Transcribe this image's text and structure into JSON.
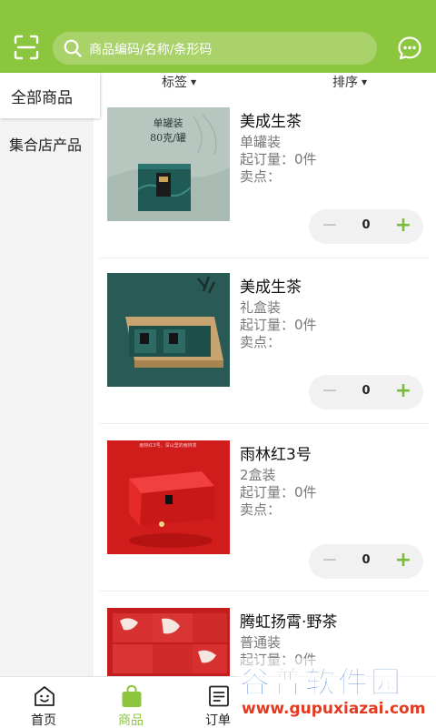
{
  "header": {
    "search_placeholder": "商品编码/名称/条形码",
    "accent_color": "#8cc63f",
    "left_icon": "scan-icon",
    "right_icon": "message-icon"
  },
  "sidebar": {
    "items": [
      {
        "label": "全部商品",
        "active": true
      },
      {
        "label": "集合店产品",
        "active": false
      }
    ]
  },
  "filters": {
    "tag_label": "标签",
    "sort_label": "排序"
  },
  "products": [
    {
      "name": "美成生茶",
      "spec": "单罐装",
      "moq": "起订量：0件",
      "selling_point": "卖点：",
      "qty": "0",
      "image_text": [
        "单罐装",
        "80克/罐"
      ]
    },
    {
      "name": "美成生茶",
      "spec": "礼盒装",
      "moq": "起订量：0件",
      "selling_point": "卖点：",
      "qty": "0"
    },
    {
      "name": "雨林红3号",
      "spec": "2盒装",
      "moq": "起订量：0件",
      "selling_point": "卖点：",
      "qty": "0",
      "image_text": [
        "雨林红3号，深山里的雨林茶"
      ]
    },
    {
      "name": "腾虹扬霄·野茶",
      "spec": "普通装",
      "moq": "起订量：0件"
    }
  ],
  "tabbar": {
    "items": [
      {
        "label": "首页",
        "icon": "home-icon",
        "active": false
      },
      {
        "label": "商品",
        "icon": "shopping-bag-icon",
        "active": true
      },
      {
        "label": "订单",
        "icon": "order-list-icon",
        "active": false
      }
    ]
  },
  "watermark": {
    "title": "谷普软件园",
    "url": "www.gupuxiazai.com"
  }
}
